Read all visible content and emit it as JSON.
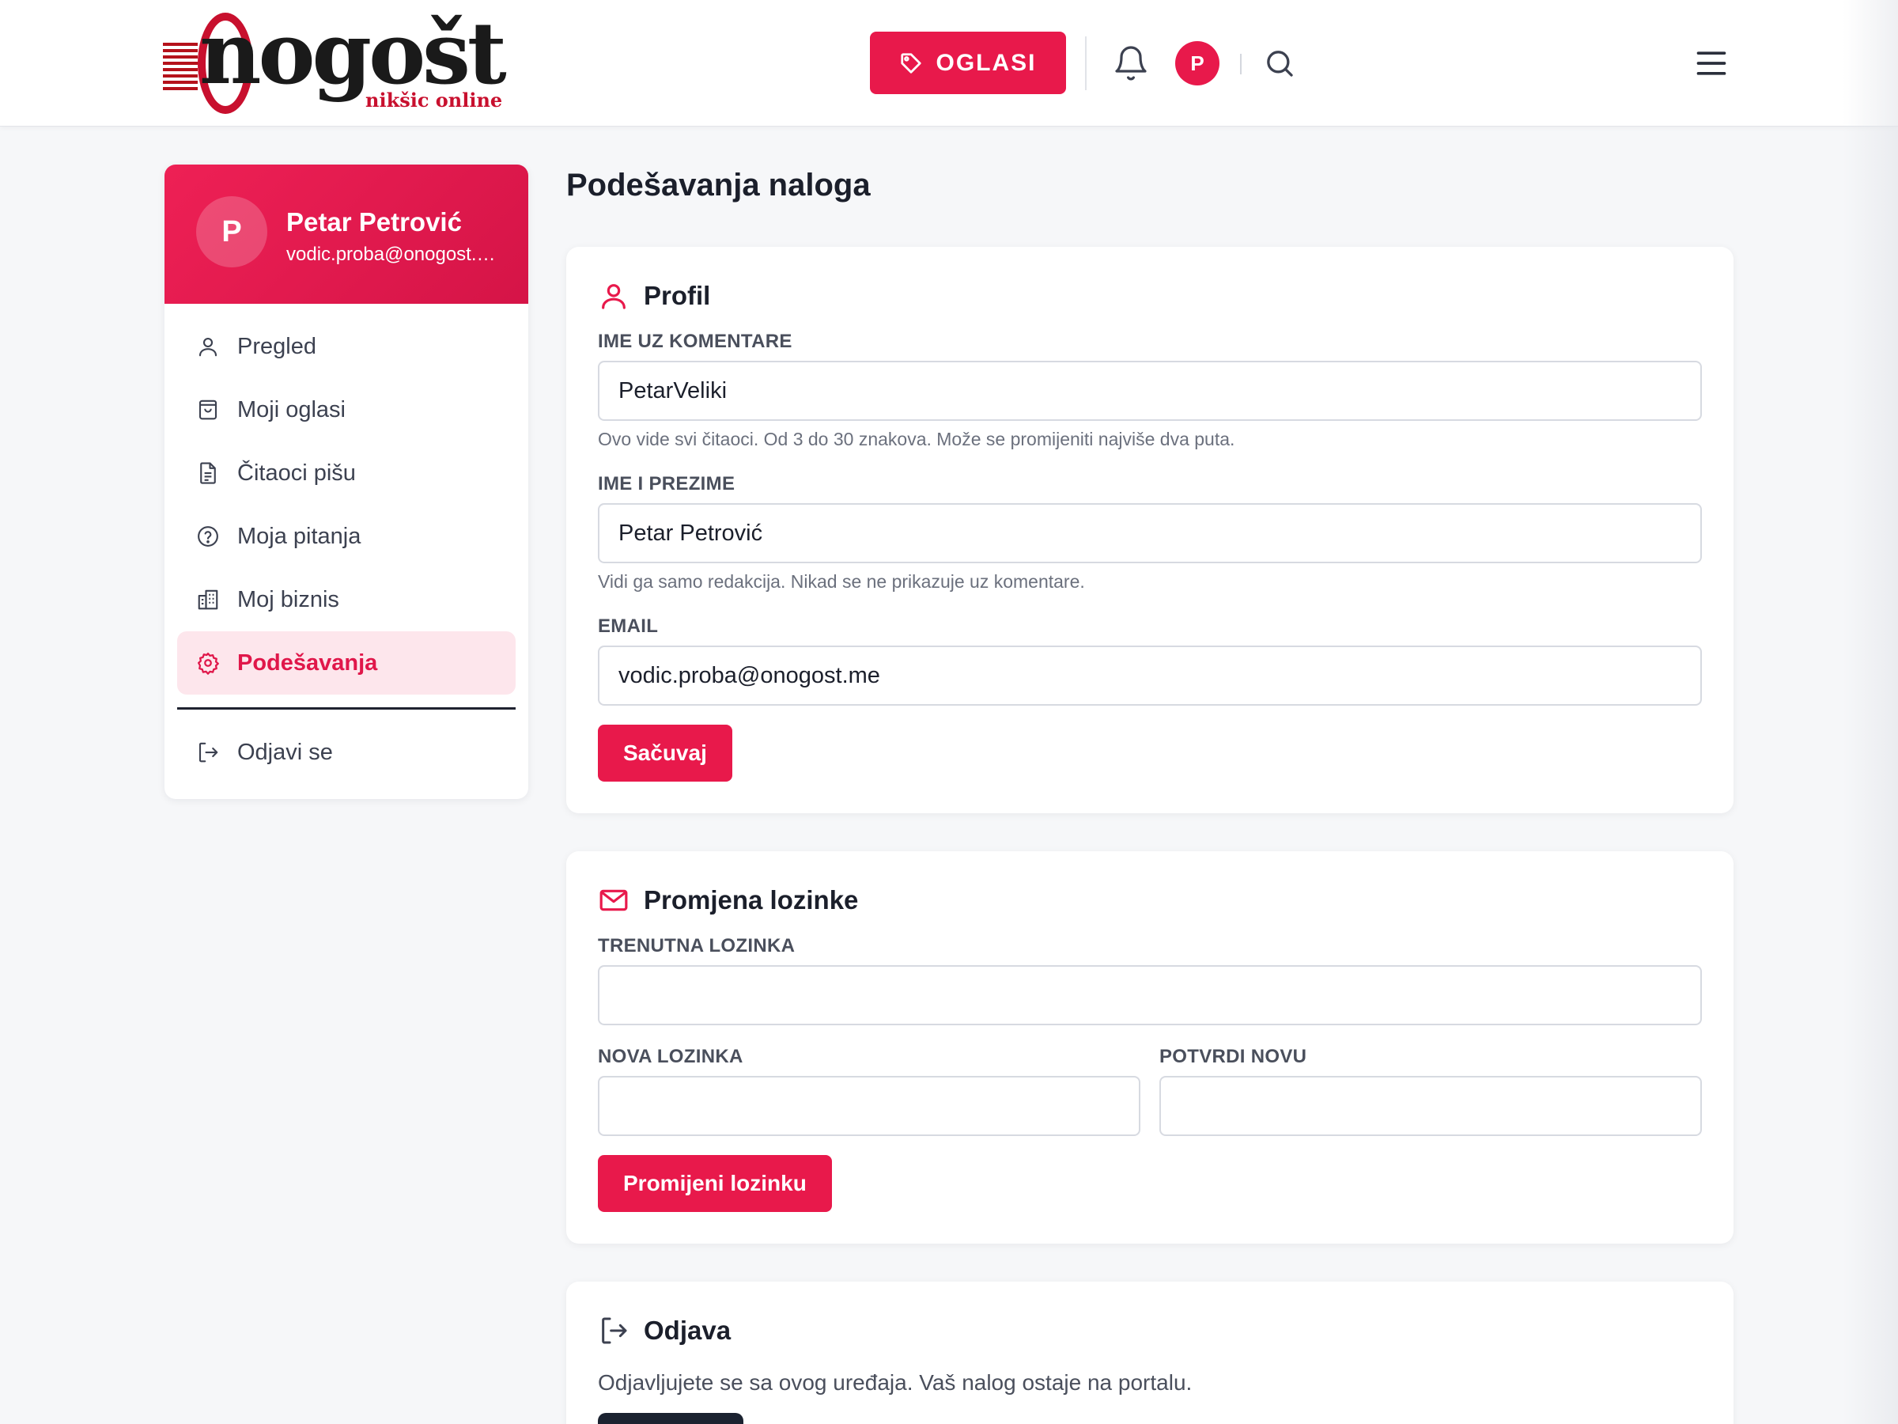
{
  "header": {
    "logo_word": "nogošt",
    "logo_subtitle": "nikšic online",
    "oglasi_label": "OGLASI",
    "avatar_initial": "P"
  },
  "sidebar": {
    "avatar_initial": "P",
    "user_name": "Petar Petrović",
    "user_email": "vodic.proba@onogost.me",
    "items": [
      {
        "label": "Pregled",
        "icon": "user-icon"
      },
      {
        "label": "Moji oglasi",
        "icon": "shopping-bag-icon"
      },
      {
        "label": "Čitaoci pišu",
        "icon": "document-icon"
      },
      {
        "label": "Moja pitanja",
        "icon": "question-circle-icon"
      },
      {
        "label": "Moj biznis",
        "icon": "building-icon"
      },
      {
        "label": "Podešavanja",
        "icon": "gear-icon",
        "active": true
      }
    ],
    "logout_label": "Odjavi se"
  },
  "main": {
    "page_title": "Podešavanja naloga",
    "profile": {
      "title": "Profil",
      "nickname_label": "IME UZ KOMENTARE",
      "nickname_value": "PetarVeliki",
      "nickname_hint": "Ovo vide svi čitaoci. Od 3 do 30 znakova. Može se promijeniti najviše dva puta.",
      "fullname_label": "IME I PREZIME",
      "fullname_value": "Petar Petrović",
      "fullname_hint": "Vidi ga samo redakcija. Nikad se ne prikazuje uz komentare.",
      "email_label": "EMAIL",
      "email_value": "vodic.proba@onogost.me",
      "save_label": "Sačuvaj"
    },
    "password": {
      "title": "Promjena lozinke",
      "current_label": "TRENUTNA LOZINKA",
      "current_value": "",
      "new_label": "NOVA LOZINKA",
      "new_value": "",
      "confirm_label": "POTVRDI NOVU",
      "confirm_value": "",
      "submit_label": "Promijeni lozinku"
    },
    "logout": {
      "title": "Odjava",
      "description": "Odjavljujete se sa ovog uređaja. Vaš nalog ostaje na portalu."
    }
  },
  "colors": {
    "accent": "#e8194b",
    "logo_red": "#c8102e",
    "active_bg": "#fde6ec",
    "dark_button": "#1b2230"
  }
}
